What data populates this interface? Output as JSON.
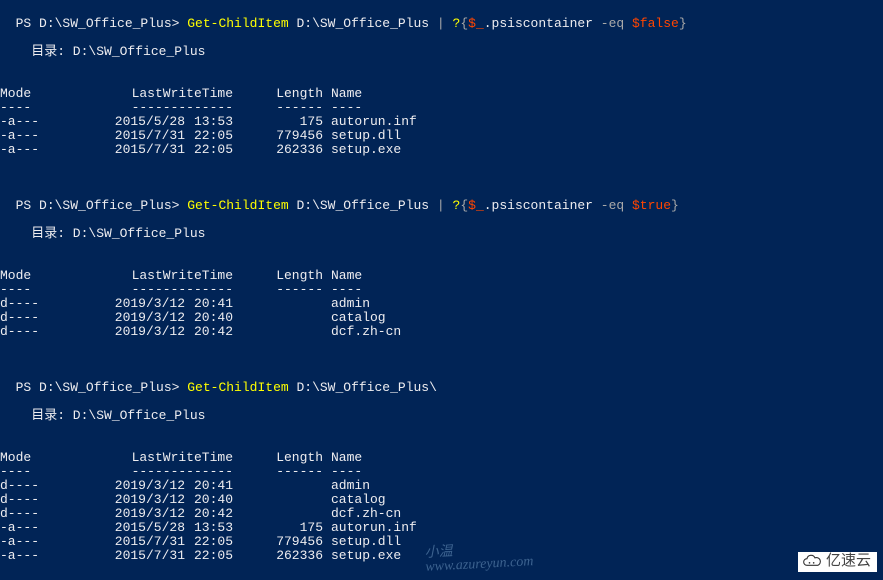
{
  "commands": [
    {
      "prompt": "PS D:\\SW_Office_Plus> ",
      "cmd": "Get-ChildItem",
      "path": " D:\\SW_Office_Plus ",
      "pipe": "| ",
      "filter_cmd": "?",
      "brace_open": "{",
      "var": "$_",
      "member": ".psiscontainer ",
      "op": "-eq ",
      "val": "$false",
      "brace_close": "}"
    },
    {
      "prompt": "PS D:\\SW_Office_Plus> ",
      "cmd": "Get-ChildItem",
      "path": " D:\\SW_Office_Plus ",
      "pipe": "| ",
      "filter_cmd": "?",
      "brace_open": "{",
      "var": "$_",
      "member": ".psiscontainer ",
      "op": "-eq ",
      "val": "$true",
      "brace_close": "}"
    },
    {
      "prompt": "PS D:\\SW_Office_Plus> ",
      "cmd": "Get-ChildItem",
      "path": " D:\\SW_Office_Plus\\"
    }
  ],
  "dir_label": "    目录: D:\\SW_Office_Plus",
  "headers": {
    "mode": "Mode",
    "lastwrite": "LastWriteTime",
    "length": "Length",
    "name": "Name"
  },
  "underlines": {
    "mode": "----",
    "lastwrite": "-------------",
    "length": "------",
    "name": "----"
  },
  "listings": [
    [
      {
        "mode": "-a---",
        "date": "2015/5/28",
        "time": "13:53",
        "length": "175",
        "name": "autorun.inf"
      },
      {
        "mode": "-a---",
        "date": "2015/7/31",
        "time": "22:05",
        "length": "779456",
        "name": "setup.dll"
      },
      {
        "mode": "-a---",
        "date": "2015/7/31",
        "time": "22:05",
        "length": "262336",
        "name": "setup.exe"
      }
    ],
    [
      {
        "mode": "d----",
        "date": "2019/3/12",
        "time": "20:41",
        "length": "",
        "name": "admin"
      },
      {
        "mode": "d----",
        "date": "2019/3/12",
        "time": "20:40",
        "length": "",
        "name": "catalog"
      },
      {
        "mode": "d----",
        "date": "2019/3/12",
        "time": "20:42",
        "length": "",
        "name": "dcf.zh-cn"
      }
    ],
    [
      {
        "mode": "d----",
        "date": "2019/3/12",
        "time": "20:41",
        "length": "",
        "name": "admin"
      },
      {
        "mode": "d----",
        "date": "2019/3/12",
        "time": "20:40",
        "length": "",
        "name": "catalog"
      },
      {
        "mode": "d----",
        "date": "2019/3/12",
        "time": "20:42",
        "length": "",
        "name": "dcf.zh-cn"
      },
      {
        "mode": "-a---",
        "date": "2015/5/28",
        "time": "13:53",
        "length": "175",
        "name": "autorun.inf"
      },
      {
        "mode": "-a---",
        "date": "2015/7/31",
        "time": "22:05",
        "length": "779456",
        "name": "setup.dll"
      },
      {
        "mode": "-a---",
        "date": "2015/7/31",
        "time": "22:05",
        "length": "262336",
        "name": "setup.exe"
      }
    ]
  ],
  "watermarks": {
    "wm1a": "小温",
    "wm1b": "www.azureyun.com",
    "wm2": "亿速云"
  }
}
